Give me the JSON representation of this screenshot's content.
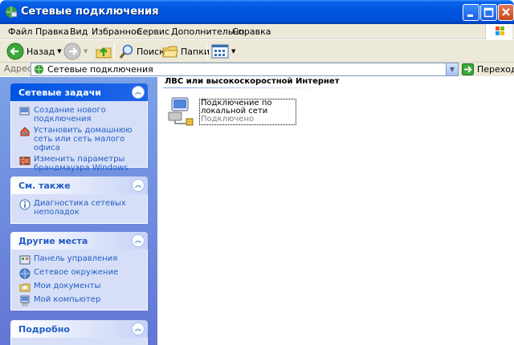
{
  "window": {
    "title": "Сетевые подключения",
    "icon": "network-connections-icon"
  },
  "menu": [
    "Файл",
    "Правка",
    "Вид",
    "Избранное",
    "Сервис",
    "Дополнительно",
    "Справка"
  ],
  "toolbar": {
    "back_label": "Назад",
    "search_label": "Поиск",
    "folders_label": "Папки"
  },
  "address": {
    "label": "Адрес:",
    "value": "Сетевые подключения",
    "go_label": "Переход"
  },
  "taskpane": {
    "network_tasks": {
      "title": "Сетевые задачи",
      "items": [
        {
          "label": "Создание нового подключения",
          "icon": "new-connection-icon"
        },
        {
          "label": "Установить домашнюю сеть или сеть малого офиса",
          "icon": "home-network-icon"
        },
        {
          "label": "Изменить параметры брандмауэра Windows",
          "icon": "firewall-icon"
        }
      ]
    },
    "see_also": {
      "title": "См. также",
      "items": [
        {
          "label": "Диагностика сетевых неполадок",
          "icon": "info-icon"
        }
      ]
    },
    "other_places": {
      "title": "Другие места",
      "items": [
        {
          "label": "Панель управления",
          "icon": "control-panel-icon"
        },
        {
          "label": "Сетевое окружение",
          "icon": "network-places-icon"
        },
        {
          "label": "Мои документы",
          "icon": "my-documents-icon"
        },
        {
          "label": "Мой компьютер",
          "icon": "my-computer-icon"
        }
      ]
    },
    "details": {
      "title": "Подробно"
    }
  },
  "content": {
    "group_title": "ЛВС или высокоскоростной Интернет",
    "connection": {
      "name": "Подключение по локальной сети",
      "status": "Подключено",
      "icon": "lan-connection-icon"
    }
  },
  "colors": {
    "titlebar": "#0054e3",
    "taskpane_bg": "#6e8ddd",
    "link": "#215dc6"
  }
}
